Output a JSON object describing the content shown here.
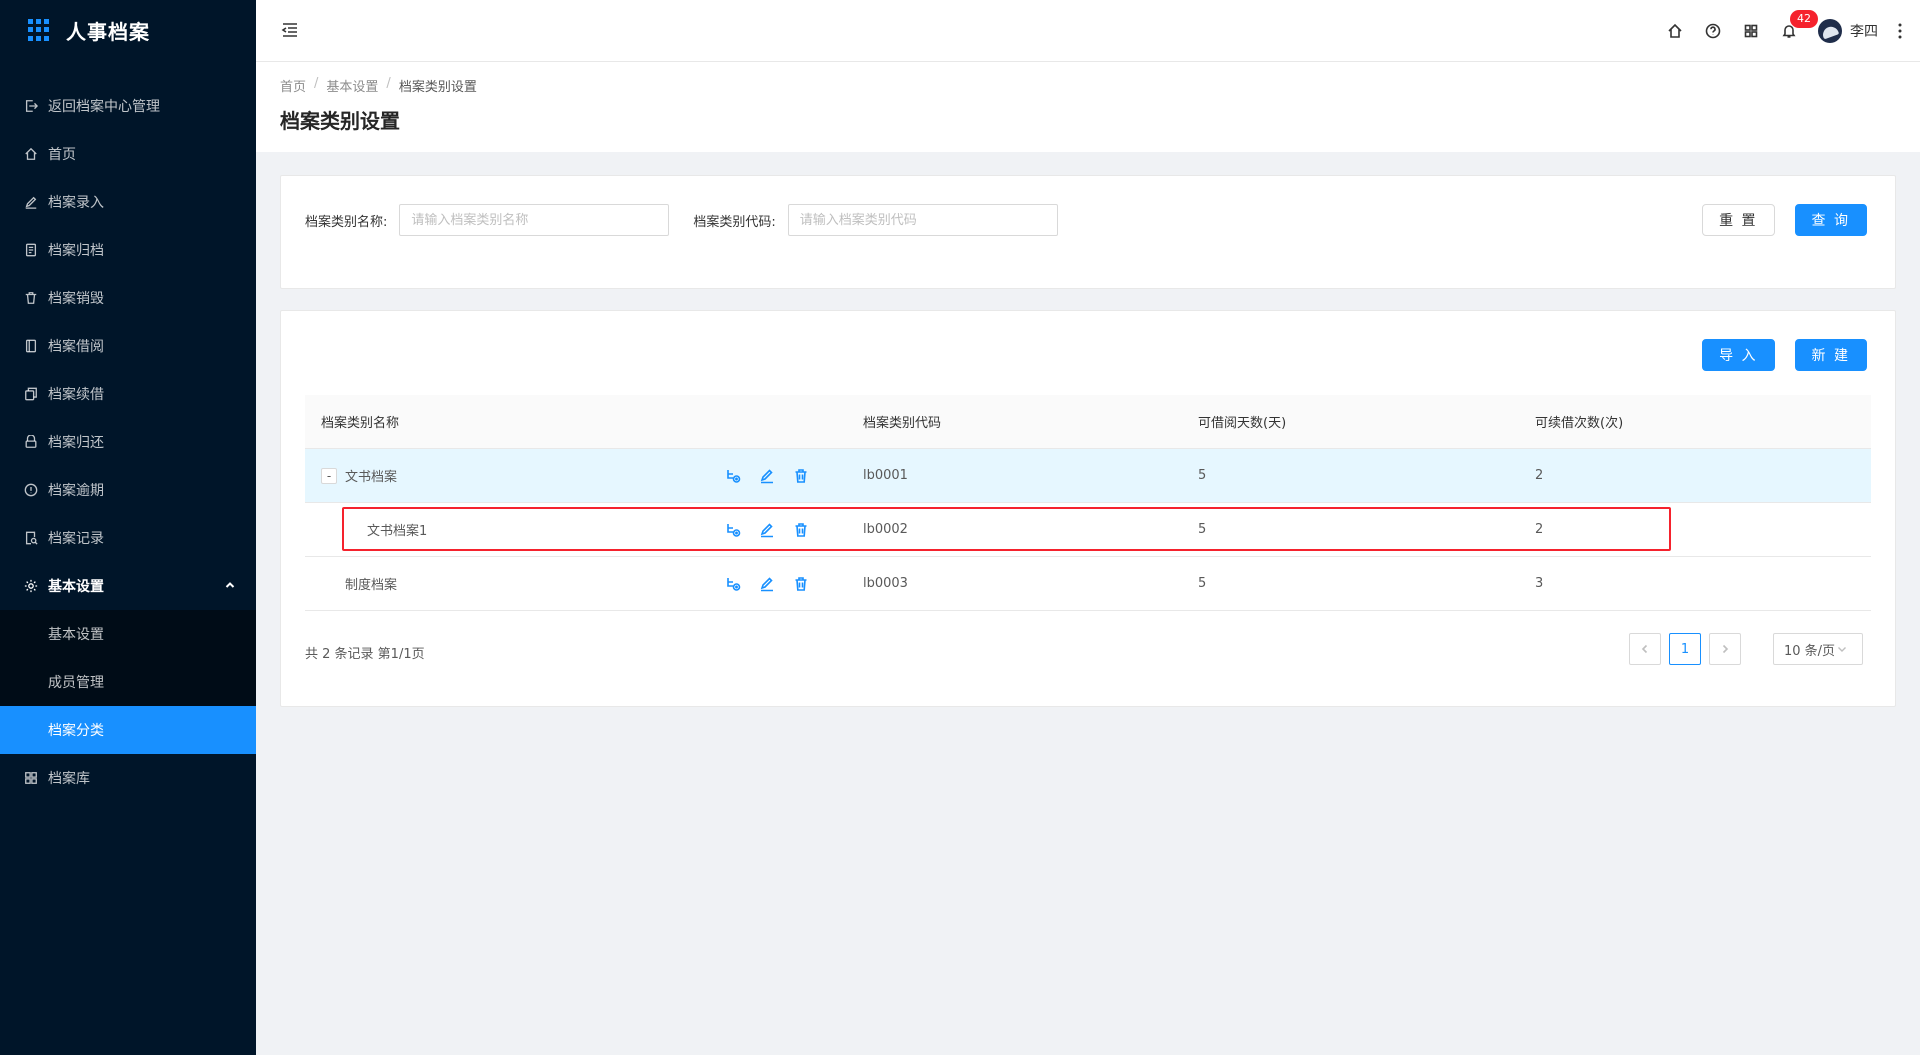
{
  "app": {
    "title": "人事档案"
  },
  "sidebar": {
    "items": [
      {
        "label": "返回档案中心管理",
        "icon": "logout-icon"
      },
      {
        "label": "首页",
        "icon": "home-icon"
      },
      {
        "label": "档案录入",
        "icon": "edit-icon"
      },
      {
        "label": "档案归档",
        "icon": "file-text-icon"
      },
      {
        "label": "档案销毁",
        "icon": "trash-icon"
      },
      {
        "label": "档案借阅",
        "icon": "book-icon"
      },
      {
        "label": "档案续借",
        "icon": "copy-icon"
      },
      {
        "label": "档案归还",
        "icon": "inbox-icon"
      },
      {
        "label": "档案逾期",
        "icon": "alert-circle-icon"
      },
      {
        "label": "档案记录",
        "icon": "file-search-icon"
      },
      {
        "label": "基本设置",
        "icon": "settings-icon"
      },
      {
        "label": "基本设置"
      },
      {
        "label": "成员管理"
      },
      {
        "label": "档案分类"
      },
      {
        "label": "档案库",
        "icon": "grid-icon"
      }
    ]
  },
  "header": {
    "notification_count": "42",
    "user_name": "李四"
  },
  "breadcrumb": {
    "home": "首页",
    "parent": "基本设置",
    "current": "档案类别设置"
  },
  "page": {
    "title": "档案类别设置"
  },
  "search": {
    "name_label": "档案类别名称:",
    "name_placeholder": "请输入档案类别名称",
    "code_label": "档案类别代码:",
    "code_placeholder": "请输入档案类别代码",
    "reset_label": "重 置",
    "query_label": "查 询"
  },
  "toolbar": {
    "import_label": "导 入",
    "new_label": "新 建"
  },
  "table": {
    "columns": [
      "档案类别名称",
      "档案类别代码",
      "可借阅天数(天)",
      "可续借次数(次)"
    ],
    "rows": [
      {
        "toggle": "-",
        "name": "文书档案",
        "code": "lb0001",
        "days": "5",
        "renewals": "2"
      },
      {
        "name": "文书档案1",
        "code": "lb0002",
        "days": "5",
        "renewals": "2"
      },
      {
        "name": "制度档案",
        "code": "lb0003",
        "days": "5",
        "renewals": "3"
      }
    ]
  },
  "pagination": {
    "total_text": "共 2 条记录 第1/1页",
    "current_page": "1",
    "page_size": "10 条/页"
  },
  "colors": {
    "primary": "#1890ff",
    "sidebar_bg": "#001529",
    "highlight_border": "#f5222d",
    "badge": "#f5222d"
  }
}
